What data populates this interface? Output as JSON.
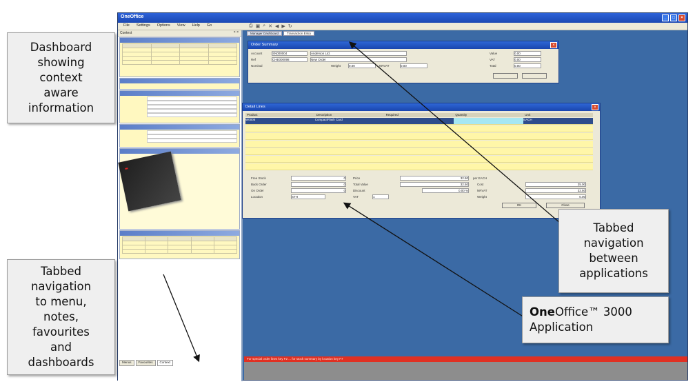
{
  "callouts": {
    "dashboard": "Dashboard\nshowing\ncontext\naware\ninformation",
    "tabbed_menu": "Tabbed\nnavigation\nto menu,\nnotes,\nfavourites\nand\ndashboards",
    "tabbed_apps": "Tabbed\nnavigation\nbetween\napplications",
    "app_brand_bold": "One",
    "app_brand_rest": "Office™ 3000",
    "app_brand_line2": "Application"
  },
  "window": {
    "title": "OneOffice",
    "menu": [
      "File",
      "Settings",
      "Options",
      "View",
      "Help",
      "Go"
    ]
  },
  "left_panel": {
    "header": "Context",
    "bottom_tabs": [
      "Menus",
      "Favourites",
      "Context"
    ]
  },
  "workspace": {
    "app_tabs": [
      "Manager Dashboard",
      "Transaction Entry"
    ]
  },
  "order_summary": {
    "title": "Order Summary",
    "labels": [
      "Account",
      "Ref",
      "Nominal",
      "Weight",
      "NRVAT",
      "Value",
      "VAT",
      "Total"
    ],
    "values": {
      "account": "SN000004",
      "account_name": "Anderson Ltd.",
      "ref": "CHE000098",
      "ref_name": "New Order",
      "value": "0.00",
      "vat": "0.00",
      "total": "0.00",
      "weight": "0.00",
      "nrvat": "0.00"
    }
  },
  "detail_lines": {
    "title": "Detail Lines",
    "columns": [
      "Product",
      "Description",
      "Required",
      "Quantity",
      "Unit"
    ],
    "first_row": {
      "product": "W0005",
      "description": "CompactFlash Card",
      "unit": "EACH"
    },
    "labels": [
      "Free Stock",
      "Back Order",
      "On Order",
      "Location",
      "Price",
      "Total Value",
      "Discount",
      "VAT",
      "Cost",
      "NRVAT",
      "Weight"
    ],
    "values": {
      "free_stock": "0",
      "back_order": "0",
      "on_order": "0",
      "location": "STH",
      "price": "32.50",
      "per": "per EACH",
      "total_value": "32.50",
      "discount": "0.00 %",
      "vat_code": "1",
      "cost": "25.00",
      "nrvat": "32.50",
      "weight": "0.00"
    },
    "ok_label": "OK",
    "close_label": "Close"
  },
  "status_bar": {
    "text": "For special order lines key F2 ... for stock summary by location key F7"
  },
  "colors": {
    "workspace_blue": "#3b6aa5",
    "status_red": "#e03022",
    "grid_yellow": "#fff6a8"
  }
}
